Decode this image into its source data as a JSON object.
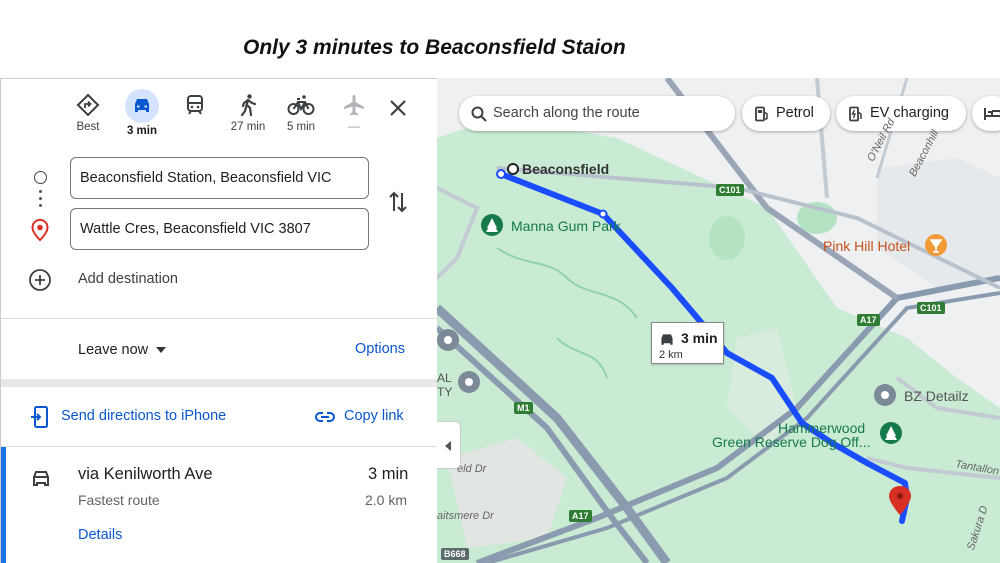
{
  "caption": "Only 3 minutes to Beaconsfield Staion",
  "travel_modes": [
    {
      "name": "best",
      "icon": "directions-icon",
      "label": "Best"
    },
    {
      "name": "driving",
      "icon": "car-icon",
      "label": "3 min",
      "active": true
    },
    {
      "name": "transit",
      "icon": "train-icon",
      "label": ""
    },
    {
      "name": "walking",
      "icon": "walk-icon",
      "label": "27 min"
    },
    {
      "name": "cycling",
      "icon": "bike-icon",
      "label": "5 min"
    },
    {
      "name": "flights",
      "icon": "plane-icon",
      "label": "—"
    }
  ],
  "origin": "Beaconsfield Station, Beaconsfield VIC",
  "destination": "Wattle Cres, Beaconsfield VIC 3807",
  "add_destination": "Add destination",
  "leave_now": "Leave now",
  "options": "Options",
  "send_directions": "Send directions to iPhone",
  "copy_link": "Copy link",
  "route": {
    "via": "via Kenilworth Ave",
    "time": "3 min",
    "subtitle": "Fastest route",
    "distance": "2.0 km",
    "details": "Details"
  },
  "map": {
    "search_placeholder": "Search along the route",
    "chips": [
      "Petrol",
      "EV charging"
    ],
    "route_box": {
      "time": "3 min",
      "distance": "2 km"
    },
    "places": {
      "start": "Beaconsfield",
      "park": "Manna Gum Park",
      "hotel": "Pink Hill Hotel",
      "business": "BZ Detailz",
      "reserve_line1": "Hammerwood",
      "reserve_line2": "Green Reserve Dog Off..."
    },
    "roads": {
      "oneil": "O'Neil Rd",
      "beaconhills": "Beaconhill",
      "tantallon": "Tantallon",
      "sakura": "Sakura D",
      "field": "eld Dr",
      "aitsmere": "aitsmere Dr",
      "al": "AL",
      "ty": "TY"
    },
    "shields": {
      "c101": "C101",
      "c101b": "C101",
      "a17": "A17",
      "a17b": "A17",
      "m1": "M1",
      "b668": "B668"
    },
    "colors": {
      "route": "#1a4dff",
      "park": "#c9ebd3",
      "road": "#8a9bb0"
    }
  }
}
